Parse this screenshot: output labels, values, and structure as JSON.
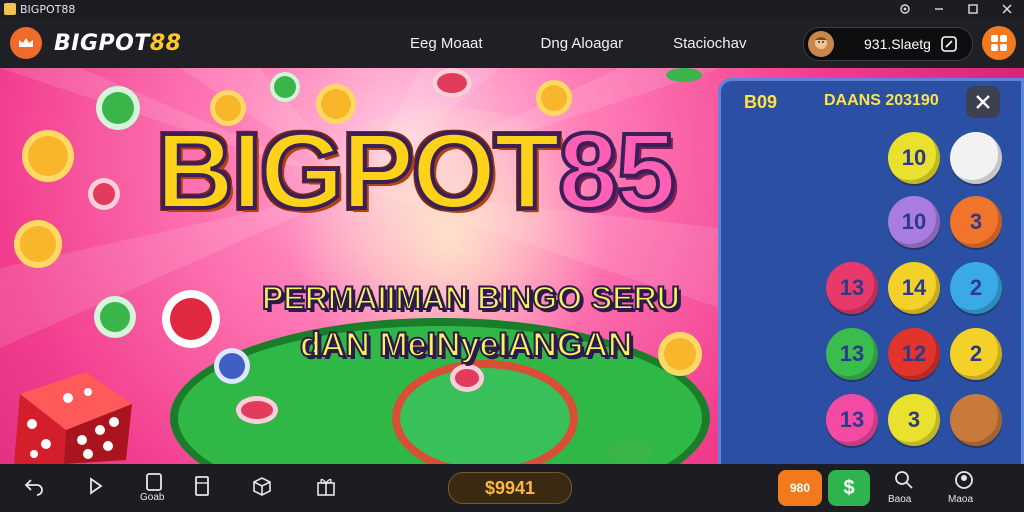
{
  "window": {
    "title": "BIGPOT88"
  },
  "header": {
    "logo_prefix": "BIGPOT",
    "logo_suffix": "88",
    "nav": [
      "Eeg Moaat",
      "Dng Aloagar",
      "Staciochav"
    ],
    "balance": "931.Slaetg"
  },
  "hero": {
    "title_part1": "BIGPOT",
    "title_part2": "85",
    "subtitle_line1": "PERMAIIMAN BINGO SERU",
    "subtitle_line2": "dAN MeINyeIANGAN"
  },
  "bingo_panel": {
    "id": "B09",
    "date": "DAANS 203190",
    "balls": [
      {
        "n": "10",
        "color": "#e9e12e"
      },
      {
        "n": "",
        "color": "#f2f2f2"
      },
      {
        "n": "10",
        "color": "#a97de0"
      },
      {
        "n": "3",
        "color": "#f0742a"
      },
      {
        "n": "13",
        "color": "#e83a6a"
      },
      {
        "n": "14",
        "color": "#f3d128"
      },
      {
        "n": "2",
        "color": "#3aa9e5"
      },
      {
        "n": "13",
        "color": "#3bbd4e"
      },
      {
        "n": "12",
        "color": "#e2342d"
      },
      {
        "n": "2",
        "color": "#f3d128"
      },
      {
        "n": "13",
        "color": "#f44aa4"
      },
      {
        "n": "3",
        "color": "#e9e12e"
      },
      {
        "n": "",
        "color": "#c87a3c"
      }
    ]
  },
  "bottom_bar": {
    "labels": [
      "Goab",
      "Baoa",
      "Maoa"
    ],
    "amount": "$9941",
    "coin_label": "980"
  },
  "colors": {
    "accent_orange": "#f47a1f",
    "panel_blue": "#2b4fa2",
    "gold": "#ffc728"
  }
}
